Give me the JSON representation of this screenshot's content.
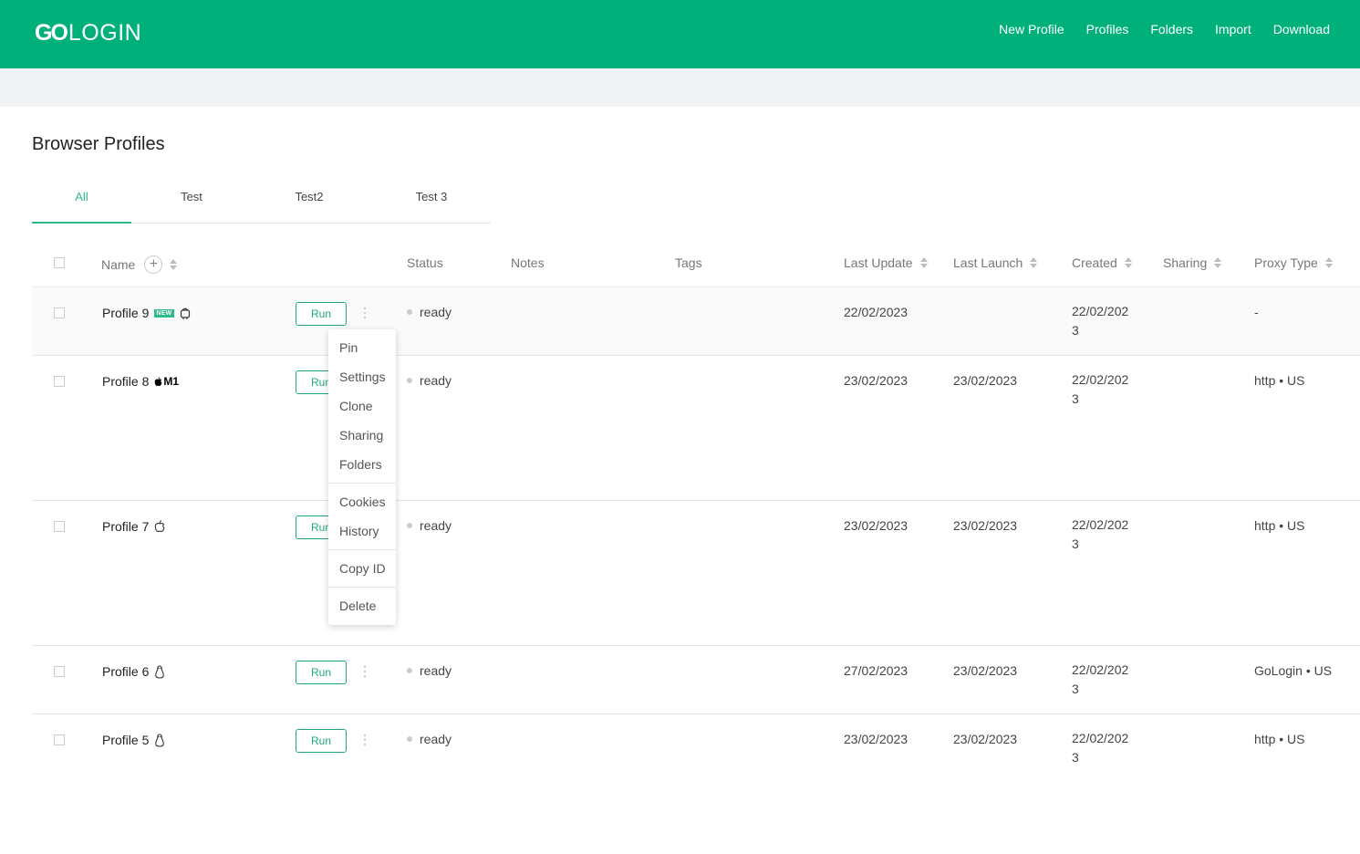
{
  "header": {
    "logo_go": "GO",
    "logo_rest": "LOGIN",
    "nav": [
      "New Profile",
      "Profiles",
      "Folders",
      "Import",
      "Download"
    ]
  },
  "page_title": "Browser Profiles",
  "tabs": [
    "All",
    "Test",
    "Test2",
    "Test 3"
  ],
  "columns": {
    "name": "Name",
    "status": "Status",
    "notes": "Notes",
    "tags": "Tags",
    "last_update": "Last Update",
    "last_launch": "Last Launch",
    "created": "Created",
    "sharing": "Sharing",
    "proxy_type": "Proxy Type"
  },
  "run_label": "Run",
  "badge_new": "NEW",
  "badge_m1": "M1",
  "rows": [
    {
      "name": "Profile 9",
      "os": "android",
      "status": "ready",
      "last_update": "22/02/2023",
      "last_launch": "",
      "created": "22/02/2023",
      "proxy": "-"
    },
    {
      "name": "Profile 8",
      "os": "mac-m1",
      "status": "ready",
      "last_update": "23/02/2023",
      "last_launch": "23/02/2023",
      "created": "22/02/2023",
      "proxy": "http • US"
    },
    {
      "name": "Profile 7",
      "os": "mac",
      "status": "ready",
      "last_update": "23/02/2023",
      "last_launch": "23/02/2023",
      "created": "22/02/2023",
      "proxy": "http • US"
    },
    {
      "name": "Profile 6",
      "os": "linux",
      "status": "ready",
      "last_update": "27/02/2023",
      "last_launch": "23/02/2023",
      "created": "22/02/2023",
      "proxy": "GoLogin • US"
    },
    {
      "name": "Profile 5",
      "os": "linux",
      "status": "ready",
      "last_update": "23/02/2023",
      "last_launch": "23/02/2023",
      "created": "22/02/2023",
      "proxy": "http • US"
    }
  ],
  "context_menu": [
    "Pin",
    "Settings",
    "Clone",
    "Sharing",
    "Folders",
    "Cookies",
    "History",
    "Copy ID",
    "Delete"
  ]
}
